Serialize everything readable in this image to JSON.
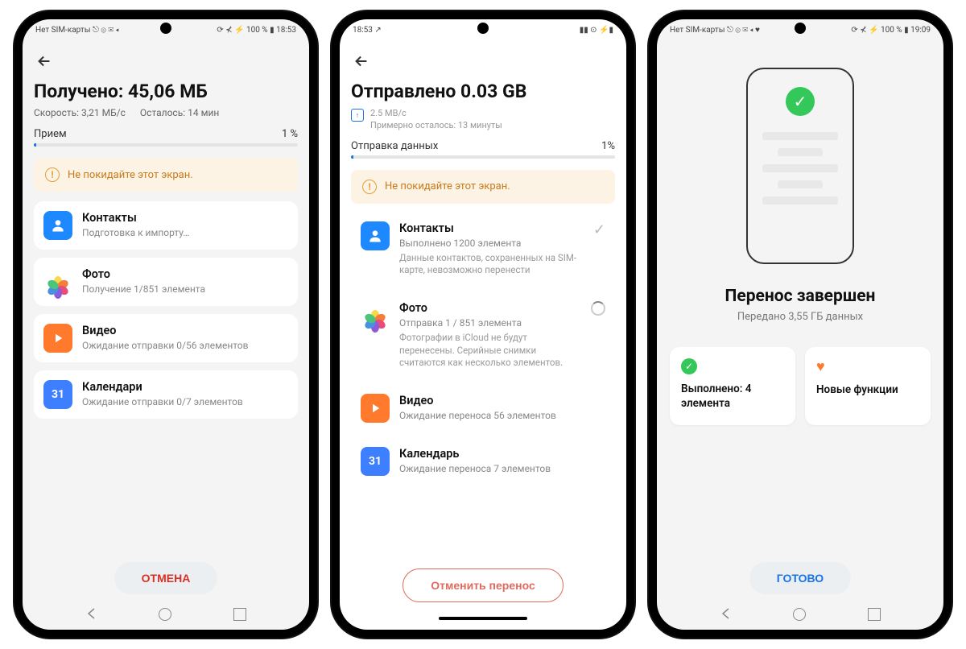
{
  "phone1": {
    "status_left": "Нет SIM-карты ⎋ ⊚ ✉ ◂",
    "status_right": "⟳ ⊀ ⚡ 100 % ▮ 18:53",
    "title": "Получено: 45,06 МБ",
    "speed": "Скорость: 3,21 МБ/с",
    "remaining": "Осталось: 14 мин",
    "progress_label": "Прием",
    "progress_pct": "1 %",
    "banner": "Не покидайте этот экран.",
    "items": [
      {
        "title": "Контакты",
        "sub": "Подготовка к импорту…",
        "icon": "contacts"
      },
      {
        "title": "Фото",
        "sub": "Получение 1/851 элемента",
        "icon": "photos"
      },
      {
        "title": "Видео",
        "sub": "Ожидание отправки 0/56 элементов",
        "icon": "video"
      },
      {
        "title": "Календари",
        "sub": "Ожидание отправки 0/7 элементов",
        "icon": "calendar",
        "num": "31"
      }
    ],
    "cancel": "ОТМЕНА"
  },
  "phone2": {
    "status_left": "18:53 ↗",
    "status_right": "▮▮ ⊙ ⚡▮",
    "title": "Отправлено 0.03 GB",
    "speed": "2.5 MB/с",
    "remaining": "Примерно осталось: 13 минуты",
    "progress_label": "Отправка данных",
    "progress_pct": "1%",
    "banner": "Не покидайте этот экран.",
    "items": [
      {
        "title": "Контакты",
        "sub": "Выполнено 1200 элемента",
        "sub2": "Данные контактов, сохраненных на SIM-карте, невозможно перенести",
        "icon": "contacts",
        "done": true
      },
      {
        "title": "Фото",
        "sub": "Отправка 1 / 851 элемента",
        "sub2": "Фотографии в iCloud не будут перенесены. Серийные снимки считаются как несколько элементов.",
        "icon": "photos",
        "loading": true
      },
      {
        "title": "Видео",
        "sub": "Ожидание переноса 56 элементов",
        "icon": "video"
      },
      {
        "title": "Календарь",
        "sub": "Ожидание переноса 7 элементов",
        "icon": "calendar",
        "num": "31"
      }
    ],
    "cancel": "Отменить перенос"
  },
  "phone3": {
    "status_left": "Нет SIM-карты ⎋ ⊚ ✉ ◂ ♥",
    "status_right": "⟳ ⊀ ⚡ 100 % ▮ 19:09",
    "title": "Перенос завершен",
    "sub": "Передано 3,55 ГБ данных",
    "tile1": "Выполнено: 4 элемента",
    "tile2": "Новые функции",
    "done": "ГОТОВО"
  }
}
